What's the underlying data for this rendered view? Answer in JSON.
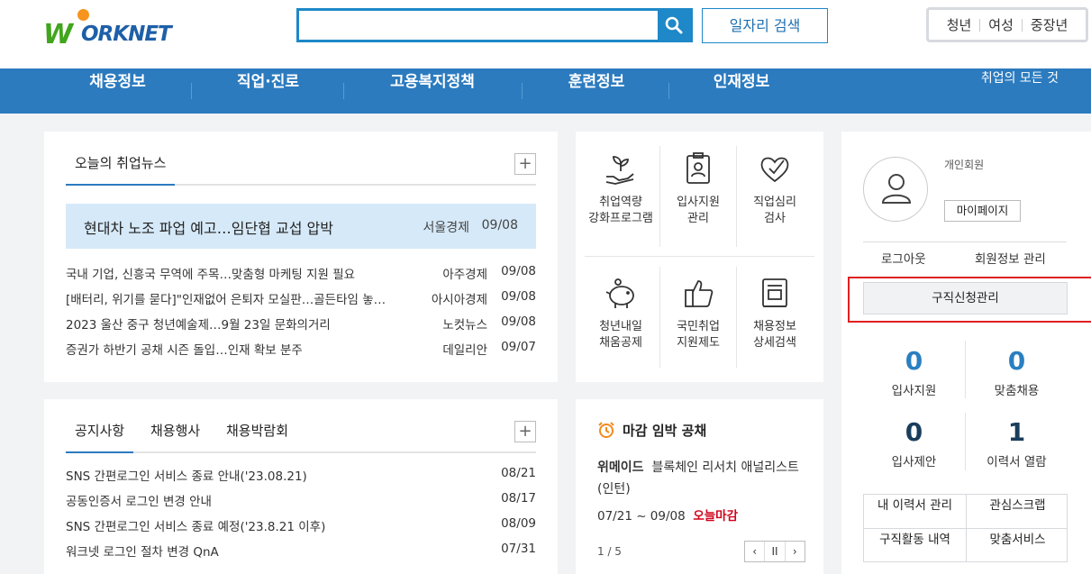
{
  "brand": {
    "logo_text": "ORKNET"
  },
  "search": {
    "placeholder": "",
    "job_search_label": "일자리 검색"
  },
  "age_tabs": [
    "청년",
    "여성",
    "중장년"
  ],
  "nav": {
    "items": [
      "채용정보",
      "직업·진로",
      "고용복지정책",
      "훈련정보",
      "인재정보"
    ],
    "all_label": "취업의 모든 것"
  },
  "news": {
    "tab_label": "오늘의 취업뉴스",
    "headline": {
      "title": "현대차 노조 파업 예고…임단협 교섭 압박",
      "source": "서울경제",
      "date": "09/08"
    },
    "rows": [
      {
        "title": "국내 기업, 신흥국 무역에 주목…맞춤형 마케팅 지원 필요",
        "source": "아주경제",
        "date": "09/08"
      },
      {
        "title": "[배터리, 위기를 묻다]\"인재없어 은퇴자 모실판…골든타임 놓…",
        "source": "아시아경제",
        "date": "09/08"
      },
      {
        "title": "2023 울산 중구 청년예술제…9월 23일 문화의거리",
        "source": "노컷뉴스",
        "date": "09/08"
      },
      {
        "title": "증권가 하반기 공채 시즌 돌입…인재 확보 분주",
        "source": "데일리안",
        "date": "09/07"
      }
    ]
  },
  "notice": {
    "tabs": [
      "공지사항",
      "채용행사",
      "채용박람회"
    ],
    "rows": [
      {
        "title": "SNS 간편로그인 서비스 종료 안내('23.08.21)",
        "date": "08/21"
      },
      {
        "title": "공동인증서 로그인 변경 안내",
        "date": "08/17"
      },
      {
        "title": "SNS 간편로그인 서비스 종료 예정('23.8.21 이후)",
        "date": "08/09"
      },
      {
        "title": "워크넷 로그인 절차 변경 QnA",
        "date": "07/31"
      }
    ]
  },
  "quick_menu": {
    "items": [
      {
        "line1": "취업역량",
        "line2": "강화프로그램",
        "icon": "plant-hand-icon"
      },
      {
        "line1": "입사지원",
        "line2": "관리",
        "icon": "id-card-icon"
      },
      {
        "line1": "직업심리",
        "line2": "검사",
        "icon": "heart-check-icon"
      },
      {
        "line1": "청년내일",
        "line2": "채움공제",
        "icon": "piggy-bank-icon"
      },
      {
        "line1": "국민취업",
        "line2": "지원제도",
        "icon": "thumbs-up-icon"
      },
      {
        "line1": "채용정보",
        "line2": "상세검색",
        "icon": "document-search-icon"
      }
    ]
  },
  "deadline": {
    "title": "마감 임박 공채",
    "company": "위메이드",
    "position": "블록체인 리서치 애널리스트(인턴)",
    "period": "07/21 ~ 09/08",
    "badge": "오늘마감",
    "pager": "1 / 5",
    "controls": [
      "‹",
      "II",
      "›"
    ]
  },
  "user": {
    "name": "개인회원",
    "mypage_label": "마이페이지",
    "logout_label": "로그아웃",
    "member_label": "회원정보 관리",
    "apply_label": "구직신청관리",
    "stats": [
      {
        "value": "0",
        "label": "입사지원"
      },
      {
        "value": "0",
        "label": "맞춤채용"
      },
      {
        "value": "0",
        "label": "입사제안"
      },
      {
        "value": "1",
        "label": "이력서 열람"
      }
    ],
    "links": [
      "내 이력서 관리",
      "관심스크랩",
      "구직활동 내역",
      "맞춤서비스"
    ]
  },
  "colors": {
    "primary": "#2c7bbf",
    "search_border": "#1e88c8",
    "highlight": "#e02020",
    "deadline_red": "#d0021b"
  }
}
